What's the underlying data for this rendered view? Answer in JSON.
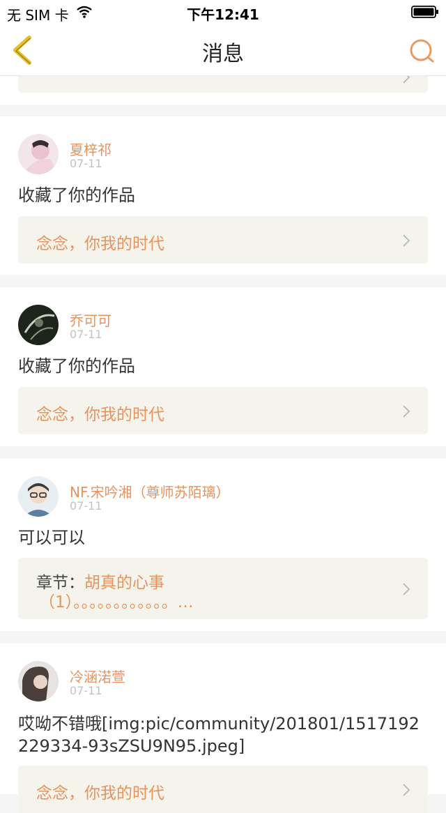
{
  "status_bar": {
    "carrier": "无 SIM 卡",
    "time": "下午12:41"
  },
  "nav": {
    "title": "消息",
    "back_icon": "back-arrow-icon",
    "search_icon": "search-icon"
  },
  "colors": {
    "accent": "#e8935e",
    "back_icon": "#e6c02a",
    "ref_bg": "#f5f4ec"
  },
  "messages": [
    {
      "user": "夏梓祁",
      "date": "07-11",
      "text": "收藏了你的作品",
      "work": "念念，你我的时代"
    },
    {
      "user": "乔可可",
      "date": "07-11",
      "text": "收藏了你的作品",
      "work": "念念，你我的时代"
    },
    {
      "user": "NF.宋吟湘（尊师苏陌璃）",
      "date": "07-11",
      "text": "可以可以",
      "chapter_label": "章节：",
      "chapter_title": "胡真的心事",
      "chapter_sub": "（1）。。。。。。。。。。。。…"
    },
    {
      "user": "冷涵渃萱",
      "date": "07-11",
      "text": "哎呦不错哦[img:pic/community/201801/1517192229334-93sZSU9N95.jpeg]",
      "work": "念念，你我的时代"
    }
  ]
}
